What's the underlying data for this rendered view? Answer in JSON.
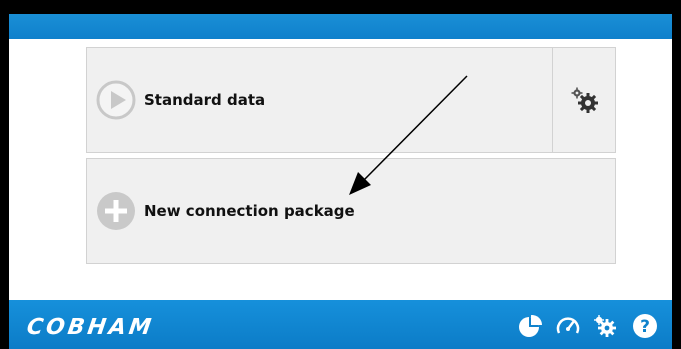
{
  "header": {
    "color": "#1088d2"
  },
  "cards": [
    {
      "label": "Standard data",
      "icon": "play-icon",
      "has_settings": true
    },
    {
      "label": "New connection package",
      "icon": "plus-icon"
    }
  ],
  "footer": {
    "brand": "COBHAM",
    "icons": [
      "pie-chart-icon",
      "speedometer-icon",
      "gears-icon",
      "help-icon"
    ],
    "color": "#1088d2"
  }
}
